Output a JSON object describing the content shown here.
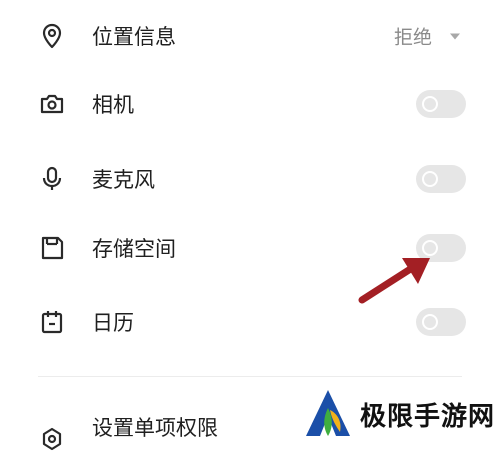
{
  "permissions": [
    {
      "label": "位置信息",
      "icon": "location-pin-icon",
      "control": "dropdown",
      "value": "拒绝"
    },
    {
      "label": "相机",
      "icon": "camera-icon",
      "control": "toggle",
      "enabled": false
    },
    {
      "label": "麦克风",
      "icon": "microphone-icon",
      "control": "toggle",
      "enabled": false
    },
    {
      "label": "存储空间",
      "icon": "storage-icon",
      "control": "toggle",
      "enabled": false
    },
    {
      "label": "日历",
      "icon": "calendar-icon",
      "control": "toggle",
      "enabled": false
    }
  ],
  "footer": {
    "label": "设置单项权限",
    "icon": "settings-icon"
  },
  "watermark": {
    "text": "极限手游网"
  },
  "colors": {
    "toggle_off": "#e6e6e6",
    "icon": "#2a2a2a",
    "arrow": "#a31f24",
    "secondary_text": "#8a8a8a"
  }
}
